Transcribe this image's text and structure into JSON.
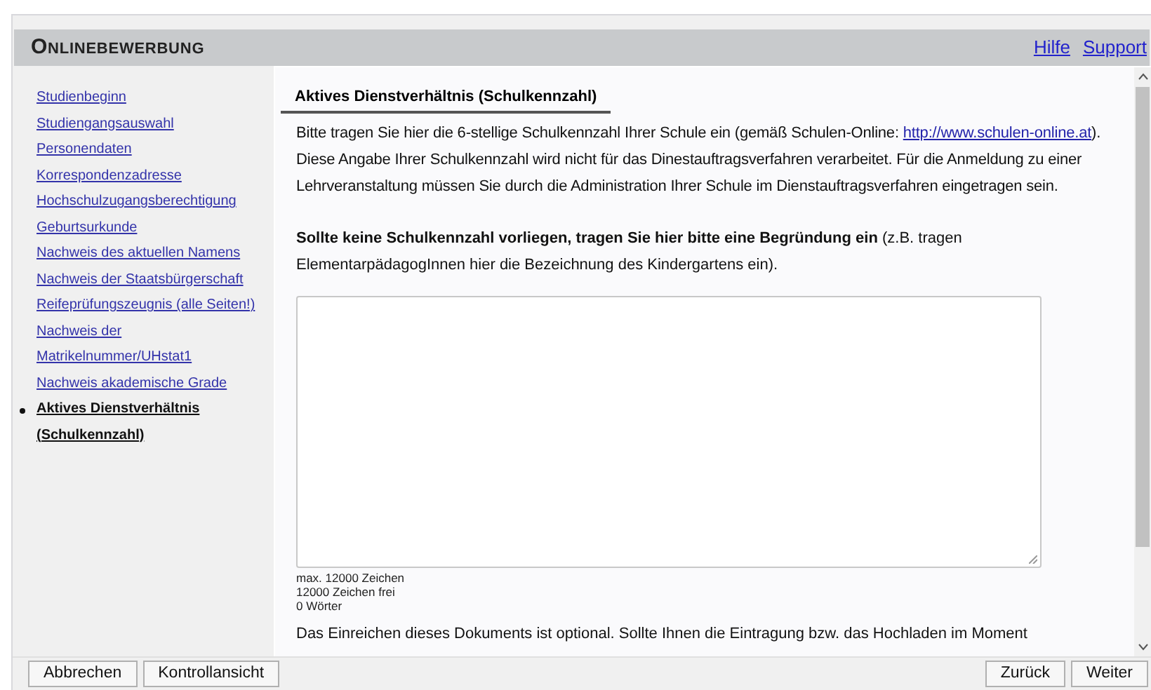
{
  "header": {
    "title": "Onlinebewerbung",
    "links": [
      "Hilfe",
      "Support"
    ]
  },
  "sidebar": {
    "items": [
      {
        "label": "Studienbeginn",
        "selected": false
      },
      {
        "label": "Studiengangsauswahl",
        "selected": false
      },
      {
        "label": "Personendaten",
        "selected": false
      },
      {
        "label": "Korrespondenzadresse",
        "selected": false
      },
      {
        "label": "Hochschulzugangsberechtigung",
        "selected": false
      },
      {
        "label": "Geburtsurkunde",
        "selected": false
      },
      {
        "label": "Nachweis des aktuellen Namens",
        "selected": false
      },
      {
        "label": "Nachweis der Staatsbürgerschaft",
        "selected": false
      },
      {
        "label": "Reifeprüfungszeugnis (alle Seiten!)",
        "selected": false
      },
      {
        "label": "Nachweis der Matrikelnummer/UHstat1",
        "selected": false
      },
      {
        "label": "Nachweis akademische Grade",
        "selected": false
      },
      {
        "label": "Aktives Dienstverhältnis (Schulkennzahl)",
        "selected": true
      }
    ]
  },
  "content": {
    "heading": "Aktives Dienstverhältnis (Schulkennzahl)",
    "intro": {
      "before": "Bitte tragen Sie hier die 6-stellige Schulkennzahl Ihrer Schule ein (gemäß Schulen-Online: ",
      "link": "http://www.schulen-online.at",
      "after": "). Diese Angabe Ihrer Schulkennzahl wird nicht für das Dinestauftragsverfahren verarbeitet. Für die Anmeldung zu einer Lehrveranstaltung müssen Sie durch die Administration Ihrer Schule im Dienstauftragsverfahren eingetragen sein."
    },
    "instruction": "**Sollte keine Schulkennzahl vorliegen, tragen Sie hier bitte eine Begründung ein** (z.B. tragen ElementarpädagogInnen hier die Bezeichnung des Kindergartens ein).",
    "counters": [
      "max. 12000 Zeichen",
      "12000 Zeichen frei",
      "0 Wörter"
    ],
    "note": "Das Einreichen dieses Dokuments ist optional. Sollte Ihnen die Eintragung bzw. das Hochladen im Moment"
  },
  "footer": {
    "left_buttons": [
      "Abbrechen",
      "Kontrollansicht"
    ],
    "right_buttons": [
      "Zurück",
      "Weiter"
    ]
  }
}
